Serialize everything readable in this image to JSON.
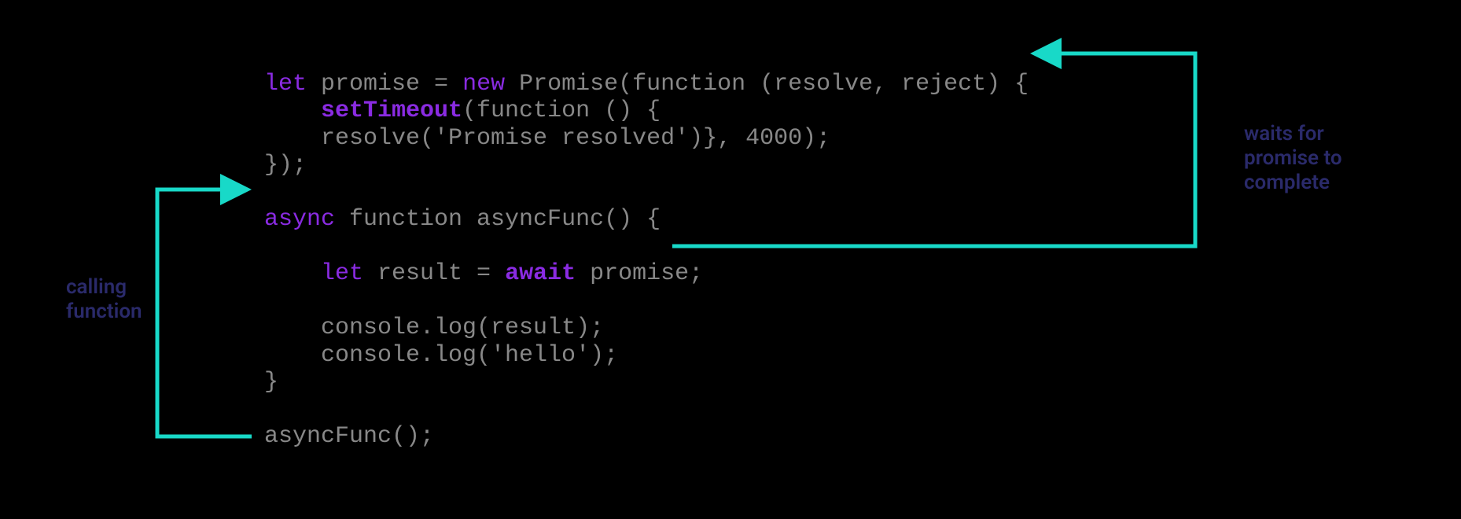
{
  "code": {
    "line1": {
      "let": "let",
      "rest1": " promise = ",
      "new": "new",
      "rest2": " Promise(function (resolve, reject) {"
    },
    "line2": {
      "indent": "    ",
      "setTimeout": "setTimeout",
      "rest": "(function () {"
    },
    "line3": "    resolve('Promise resolved')}, 4000);",
    "line4": "});",
    "blank1": "",
    "line5": {
      "async": "async",
      "rest": " function asyncFunc() {"
    },
    "blank2": "",
    "line6": {
      "indent": "    ",
      "let": "let",
      "mid": " result = ",
      "await": "await",
      "rest": " promise;"
    },
    "blank3": "",
    "line7": "    console.log(result);",
    "line8": "    console.log('hello');",
    "line9": "}",
    "blank4": "",
    "line10": "asyncFunc();"
  },
  "annotations": {
    "left_line1": "calling",
    "left_line2": "function",
    "right_line1": "waits for",
    "right_line2": "promise to",
    "right_line3": "complete"
  },
  "colors": {
    "keyword": "#8a2be2",
    "text": "#888888",
    "arrow": "#18d9c8",
    "annotation": "#2a2a6a",
    "background": "#000000"
  }
}
